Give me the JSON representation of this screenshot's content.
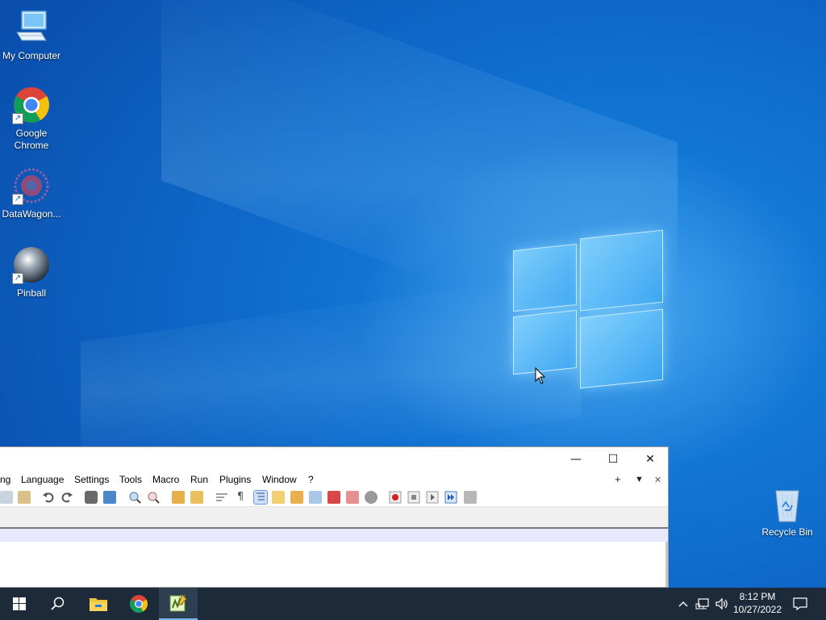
{
  "desktop": {
    "icons": [
      {
        "label": "My Computer",
        "icon": "computer-icon"
      },
      {
        "label": "Google\nChrome",
        "icon": "chrome-icon"
      },
      {
        "label": "DataWagon...",
        "icon": "datawagon-icon"
      },
      {
        "label": "Pinball",
        "icon": "pinball-icon"
      }
    ],
    "recycle_bin": {
      "label": "Recycle Bin",
      "icon": "recycle-bin-icon"
    }
  },
  "app": {
    "menu": [
      "ng",
      "Language",
      "Settings",
      "Tools",
      "Macro",
      "Run",
      "Plugins",
      "Window",
      "?"
    ],
    "menu_right": {
      "add": "+",
      "dropdown": "▼",
      "close": "✕"
    },
    "window_controls": {
      "minimize": "—",
      "maximize": "☐",
      "close": "✕"
    }
  },
  "taskbar": {
    "items": [
      "start-icon",
      "search-icon",
      "file-explorer-icon",
      "chrome-icon",
      "notepad-plus-plus-icon"
    ],
    "active_item": "notepad-plus-plus-icon",
    "tray": {
      "chevron": "^",
      "time": "8:12 PM",
      "date": "10/27/2022"
    }
  },
  "colors": {
    "desktop_blue": "#0f6fcf",
    "taskbar": "#1c2a3a",
    "accent": "#76b9ed"
  }
}
